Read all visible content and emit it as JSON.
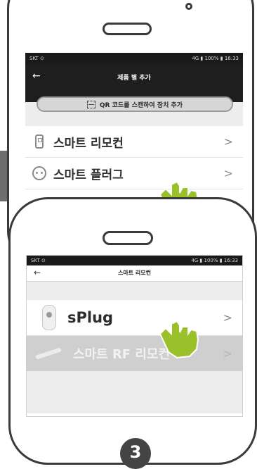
{
  "screen1": {
    "status": {
      "carrier": "SKT ⊙",
      "right": "4G ▮ 100% ▮ 16:33"
    },
    "title": "제품 별 추가",
    "qr_button": "QR 코드를 스캔하여 장치 추가",
    "items": [
      {
        "label": "스마트 리모컨",
        "icon": "remote-icon"
      },
      {
        "label": "스마트 플러그",
        "icon": "plug-icon"
      }
    ],
    "chevron": ">"
  },
  "screen2": {
    "status": {
      "carrier": "SKT ⊙",
      "right": "4G ▮ 100% ▮ 16:33"
    },
    "title": "스마트 리모컨",
    "items": [
      {
        "label": "sPlug",
        "icon": "splug-icon"
      },
      {
        "label": "스마트 RF 리모컨",
        "icon": "rf-remote-icon"
      }
    ],
    "chevron": ">"
  },
  "step_number": "3",
  "colors": {
    "hand": "#9ac02a",
    "appbar_dark": "#1e1e1e",
    "frame": "#3a3a3a",
    "badge": "#444444"
  }
}
